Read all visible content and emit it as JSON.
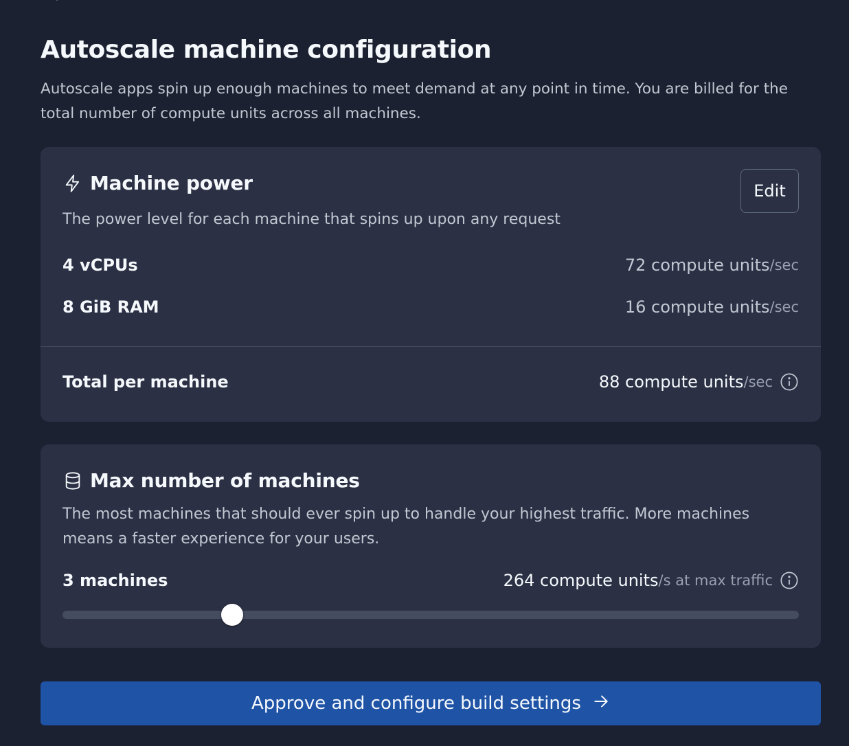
{
  "page": {
    "title": "Autoscale machine configuration",
    "description": "Autoscale apps spin up enough machines to meet demand at any point in time. You are billed for the total number of compute units across all machines."
  },
  "machine_power": {
    "icon": "lightning-icon",
    "title": "Machine power",
    "edit_label": "Edit",
    "description": "The power level for each machine that spins up upon any request",
    "specs": [
      {
        "name": "4 vCPUs",
        "value": "72 compute units",
        "unit": "/sec"
      },
      {
        "name": "8 GiB RAM",
        "value": "16 compute units",
        "unit": "/sec"
      }
    ],
    "total": {
      "name": "Total per machine",
      "value": "88 compute units",
      "unit": "/sec",
      "icon": "info-icon"
    }
  },
  "max_machines": {
    "icon": "database-icon",
    "title": "Max number of machines",
    "description": "The most machines that should ever spin up to handle your highest traffic. More machines means a faster experience for your users.",
    "count_label": "3 machines",
    "value": "264 compute units",
    "unit": "/s at max traffic",
    "info_icon": "info-icon",
    "slider_fraction": 0.23
  },
  "approve_button": {
    "label": "Approve and configure build settings",
    "icon": "arrow-right-icon"
  },
  "colors": {
    "background": "#1c2131",
    "card": "#2b3044",
    "primary": "#1f53a6"
  }
}
